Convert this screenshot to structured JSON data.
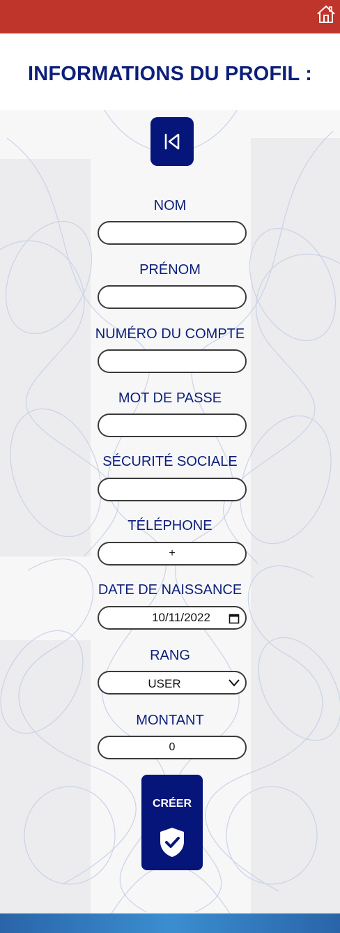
{
  "header": {
    "home_icon": "home-icon",
    "accent": "#c0352b"
  },
  "page": {
    "title": "INFORMATIONS DU PROFIL :"
  },
  "back_button": {
    "icon": "skip-back-icon"
  },
  "form": {
    "fields": [
      {
        "label": "NOM",
        "value": ""
      },
      {
        "label": "PRÉNOM",
        "value": ""
      },
      {
        "label": "NUMÉRO DU COMPTE",
        "value": ""
      },
      {
        "label": "MOT DE PASSE",
        "value": ""
      },
      {
        "label": "SÉCURITÉ SOCIALE",
        "value": ""
      },
      {
        "label": "TÉLÉPHONE",
        "value": "+"
      },
      {
        "label": "DATE DE NAISSANCE",
        "value": "10/11/2022"
      },
      {
        "label": "RANG",
        "value": "USER"
      },
      {
        "label": "MONTANT",
        "value": "0"
      }
    ]
  },
  "create_button": {
    "label": "CRÉER",
    "icon": "shield-check-icon"
  },
  "colors": {
    "primary": "#06157a",
    "title": "#0c1f7a",
    "footer": "#3a8ed0"
  }
}
